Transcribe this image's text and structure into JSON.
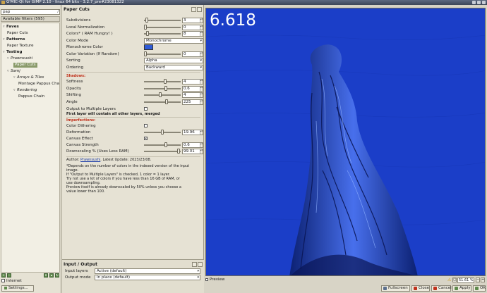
{
  "window": {
    "title": "G'MIC-Qt for GIMP 2.10 - linux 64 bits - 3.2.7_pre#23081322"
  },
  "left": {
    "search_value": "pap",
    "available_filters": "Available filters (595)",
    "tree": [
      {
        "label": "Faves",
        "style": "bold",
        "twisty": "▿"
      },
      {
        "label": "Paper Cuts",
        "style": "",
        "twisty": ""
      },
      {
        "label": "Patterns",
        "style": "bold",
        "twisty": "▿"
      },
      {
        "label": "Paper Texture",
        "style": "",
        "twisty": ""
      },
      {
        "label": "Testing",
        "style": "bold",
        "twisty": "▿"
      },
      {
        "label": "Prawnsushi",
        "style": "ital",
        "twisty": "▿"
      },
      {
        "label": "Paper Cuts",
        "style": "sel",
        "twisty": ""
      },
      {
        "label": "Samj",
        "style": "ital",
        "twisty": "▿"
      },
      {
        "label": "Arrays & Tiles",
        "style": "ital",
        "twisty": "▿"
      },
      {
        "label": "Montage Pappus Cha",
        "style": "",
        "twisty": ""
      },
      {
        "label": "Rendering",
        "style": "ital",
        "twisty": "▿"
      },
      {
        "label": "Pappus Chain",
        "style": "",
        "twisty": ""
      }
    ],
    "internet_label": "Internet",
    "settings_label": "Settings..."
  },
  "filter": {
    "title": "Paper Cuts",
    "params": [
      {
        "label": "Subdivisions",
        "type": "slider",
        "value": "3",
        "pos": 0.05
      },
      {
        "label": "Local Normalization",
        "type": "slider",
        "value": "0",
        "pos": 0.0
      },
      {
        "label": "Colors* ( RAM Hungry! )",
        "type": "slider",
        "value": "8",
        "pos": 0.06
      },
      {
        "label": "Color Mode",
        "type": "combo",
        "value": "Monochrome"
      },
      {
        "label": "Monochrome Color",
        "type": "color",
        "value": "#2e5bd7"
      },
      {
        "label": "Color Variation (If Random)",
        "type": "slider",
        "value": "0",
        "pos": 0.0
      },
      {
        "label": "Sorting",
        "type": "combo",
        "value": "Alpha"
      },
      {
        "label": "Ordering",
        "type": "combo",
        "value": "Backward"
      }
    ],
    "shadows_header": "Shadows:",
    "shadow_params": [
      {
        "label": "Softness",
        "type": "slider",
        "value": "4",
        "pos": 0.58
      },
      {
        "label": "Opacity",
        "type": "slider",
        "value": "0.6",
        "pos": 0.6
      },
      {
        "label": "Shifting",
        "type": "slider",
        "value": "4",
        "pos": 0.44
      },
      {
        "label": "Angle",
        "type": "slider",
        "value": "225",
        "pos": 0.62
      }
    ],
    "output_multiple_label": "Output to Multiple Layers",
    "first_layer_note": "First layer will contain all other layers, merged",
    "imperfections_header": "Imperfections:",
    "imp_params": [
      {
        "label": "Color Dithering",
        "type": "check",
        "value": ""
      },
      {
        "label": "Deformation",
        "type": "slider",
        "value": "19.96",
        "pos": 0.5
      },
      {
        "label": "Canvas Effect",
        "type": "check",
        "value": "✕"
      },
      {
        "label": "Canvas Strength",
        "type": "slider",
        "value": "0.6",
        "pos": 0.6
      },
      {
        "label": "Downscaling % (Uses Less RAM)",
        "type": "slider",
        "value": "99.01",
        "pos": 0.97
      }
    ],
    "author_prefix": "Author:",
    "author_name": "Prawnsushi",
    "author_suffix": ". Latest Update: 2023/23/08.",
    "notes": [
      "*Depends on the number of colors in the indexed version of the input",
      "image.",
      "If \"Output to Multiple Layers\" is checked, 1 color = 1 layer.",
      "Try not use a lot of colors if you have less than 16 GB of RAM, or",
      "use downsampling.",
      "Preview itself is already downscaled by 50% unless you choose a",
      "value lower than 100."
    ]
  },
  "io": {
    "title": "Input / Output",
    "input_label": "Input layers",
    "input_value": "Active (default)",
    "output_label": "Output mode",
    "output_value": "In place (default)"
  },
  "preview": {
    "timing": "6.618",
    "label": "Preview",
    "zoom": "51.61 %",
    "bg_color": "#1b3ec8"
  },
  "buttons": {
    "fullscreen": "Fullscreen",
    "close": "Close",
    "cancel": "Cancel",
    "apply": "Apply",
    "ok": "OK"
  }
}
